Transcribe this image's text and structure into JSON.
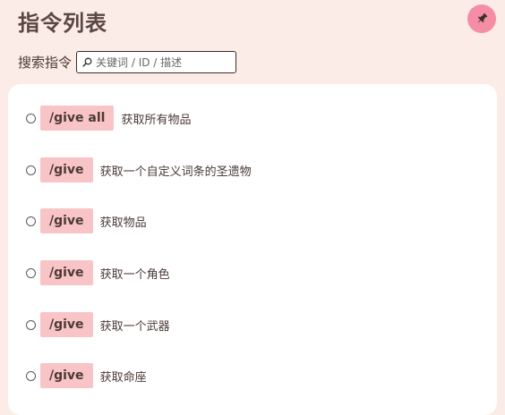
{
  "header": {
    "title": "指令列表",
    "pin_icon": "pin-icon",
    "accent_color": "#f58ea4"
  },
  "search": {
    "label": "搜索指令",
    "placeholder": "关键词 / ID / 描述",
    "value": "",
    "icon": "search-icon"
  },
  "commands": [
    {
      "command": "/give all",
      "description": "获取所有物品"
    },
    {
      "command": "/give",
      "description": "获取一个自定义词条的圣遗物"
    },
    {
      "command": "/give",
      "description": "获取物品"
    },
    {
      "command": "/give",
      "description": "获取一个角色"
    },
    {
      "command": "/give",
      "description": "获取一个武器"
    },
    {
      "command": "/give",
      "description": "获取命座"
    }
  ],
  "colors": {
    "background": "#fbece7",
    "tag": "#f9c4c5",
    "panel": "#ffffff"
  }
}
